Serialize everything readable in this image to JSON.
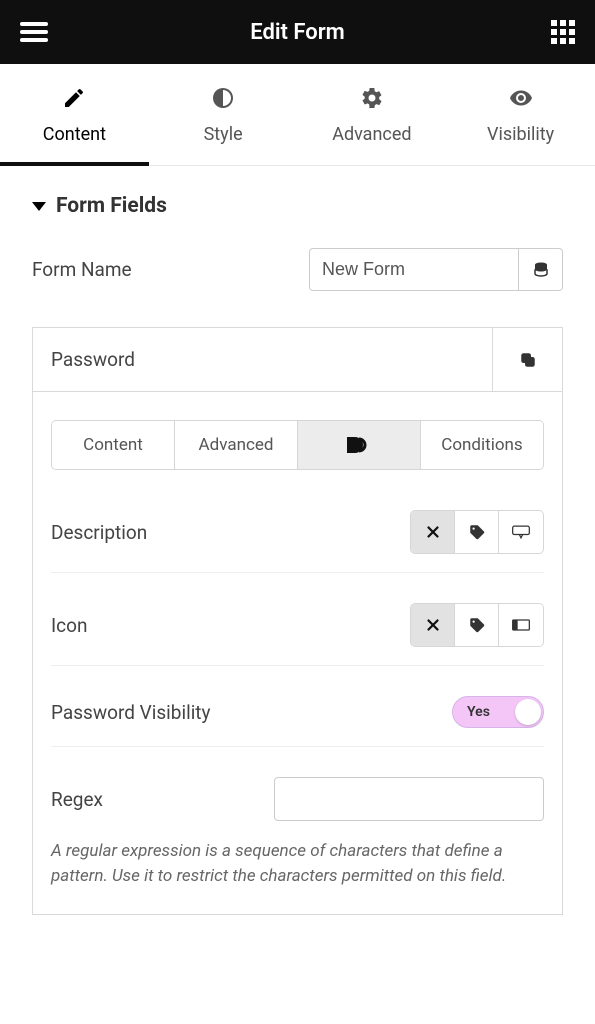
{
  "header": {
    "title": "Edit Form"
  },
  "main_tabs": [
    {
      "label": "Content",
      "icon": "pencil-icon"
    },
    {
      "label": "Style",
      "icon": "contrast-icon"
    },
    {
      "label": "Advanced",
      "icon": "gear-icon"
    },
    {
      "label": "Visibility",
      "icon": "eye-icon"
    }
  ],
  "section": {
    "title": "Form Fields",
    "form_name": {
      "label": "Form Name",
      "value": "New Form"
    }
  },
  "card": {
    "title": "Password",
    "inner_tabs": [
      {
        "label": "Content"
      },
      {
        "label": "Advanced"
      },
      {
        "label": "",
        "icon": "d-logo-icon"
      },
      {
        "label": "Conditions"
      }
    ],
    "fields": {
      "description": {
        "label": "Description"
      },
      "icon": {
        "label": "Icon"
      },
      "password_visibility": {
        "label": "Password Visibility",
        "toggle_value": "Yes"
      },
      "regex": {
        "label": "Regex",
        "value": "",
        "help": "A regular expression is a sequence of characters that define a pattern. Use it to restrict the characters permitted on this field."
      }
    }
  }
}
